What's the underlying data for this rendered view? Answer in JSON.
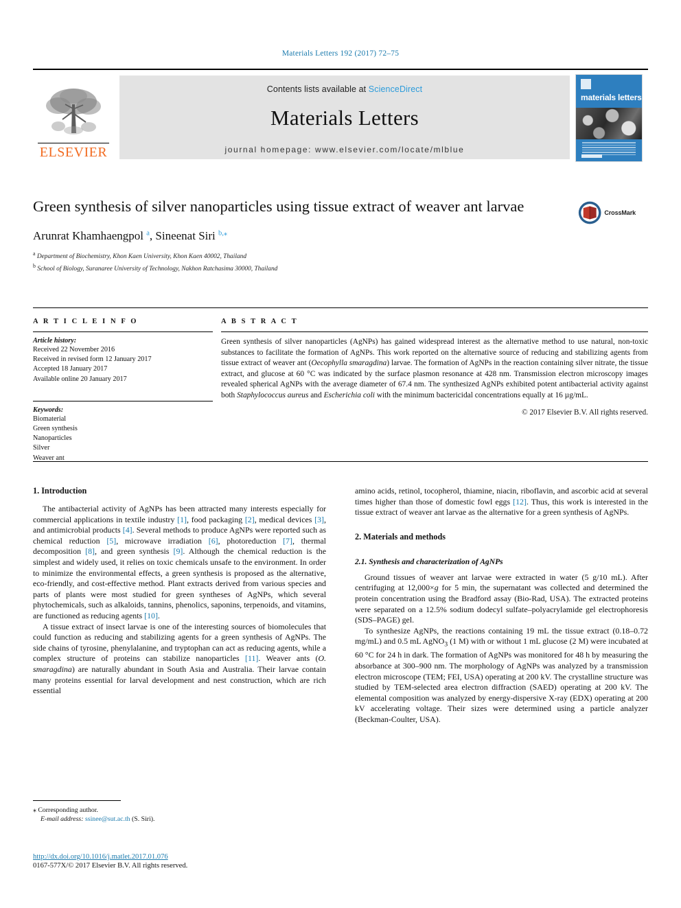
{
  "running_head": "Materials Letters 192 (2017) 72–75",
  "masthead": {
    "publisher": "ELSEVIER",
    "contents_prefix": "Contents lists available at ",
    "sciencedirect": "ScienceDirect",
    "journal_name": "Materials Letters",
    "homepage": "journal homepage: www.elsevier.com/locate/mlblue",
    "cover_title": "materials letters"
  },
  "article": {
    "title": "Green synthesis of silver nanoparticles using tissue extract of weaver ant larvae",
    "crossmark_label": "CrossMark",
    "authors_html": "Arunrat Khamhaengpol <sup>a</sup>, Sineenat Siri <sup>b,</sup><sup>⁎</sup>",
    "affiliation_a": "Department of Biochemistry, Khon Kaen University, Khon Kaen 40002, Thailand",
    "affiliation_b": "School of Biology, Suranaree University of Technology, Nakhon Ratchasima 30000, Thailand"
  },
  "article_info": {
    "heading": "A R T I C L E    I N F O",
    "history_label": "Article history:",
    "history": [
      "Received 22 November 2016",
      "Received in revised form 12 January 2017",
      "Accepted 18 January 2017",
      "Available online 20 January 2017"
    ],
    "keywords_label": "Keywords:",
    "keywords": [
      "Biomaterial",
      "Green synthesis",
      "Nanoparticles",
      "Silver",
      "Weaver ant"
    ]
  },
  "abstract": {
    "heading": "A B S T R A C T",
    "text_html": "Green synthesis of silver nanoparticles (AgNPs) has gained widespread interest as the alternative method to use natural, non-toxic substances to facilitate the formation of AgNPs. This work reported on the alternative source of reducing and stabilizing agents from tissue extract of weaver ant (<i>Oecophylla smaragdina</i>) larvae. The formation of AgNPs in the reaction containing silver nitrate, the tissue extract, and glucose at 60 °C was indicated by the surface plasmon resonance at 428 nm. Transmission electron microscopy images revealed spherical AgNPs with the average diameter of 67.4 nm. The synthesized AgNPs exhibited potent antibacterial activity against both <i>Staphylococcus aureus</i> and <i>Escherichia coli</i> with the minimum bactericidal concentrations equally at 16 µg/mL.",
    "copyright": "© 2017 Elsevier B.V. All rights reserved."
  },
  "sections": {
    "intro_heading": "1. Introduction",
    "intro_p1_html": "The antibacterial activity of AgNPs has been attracted many interests especially for commercial applications in textile industry <span class=\"ref\">[1]</span>, food packaging <span class=\"ref\">[2]</span>, medical devices <span class=\"ref\">[3]</span>, and antimicrobial products <span class=\"ref\">[4]</span>. Several methods to produce AgNPs were reported such as chemical reduction <span class=\"ref\">[5]</span>, microwave irradiation <span class=\"ref\">[6]</span>, photoreduction <span class=\"ref\">[7]</span>, thermal decomposition <span class=\"ref\">[8]</span>, and green synthesis <span class=\"ref\">[9]</span>. Although the chemical reduction is the simplest and widely used, it relies on toxic chemicals unsafe to the environment. In order to minimize the environmental effects, a green synthesis is proposed as the alternative, eco-friendly, and cost-effective method. Plant extracts derived from various species and parts of plants were most studied for green syntheses of AgNPs, which several phytochemicals, such as alkaloids, tannins, phenolics, saponins, terpenoids, and vitamins, are functioned as reducing agents <span class=\"ref\">[10]</span>.",
    "intro_p2_html": "A tissue extract of insect larvae is one of the interesting sources of biomolecules that could function as reducing and stabilizing agents for a green synthesis of AgNPs. The side chains of tyrosine, phenylalanine, and tryptophan can act as reducing agents, while a complex structure of proteins can stabilize nanoparticles <span class=\"ref\">[11]</span>. Weaver ants (<i>O. smaragdina</i>) are naturally abundant in South Asia and Australia. Their larvae contain many proteins essential for larval development and nest construction, which are rich essential",
    "intro_p2_cont_html": "amino acids, retinol, tocopherol, thiamine, niacin, riboflavin, and ascorbic acid at several times higher than those of domestic fowl eggs <span class=\"ref\">[12]</span>. Thus, this work is interested in the tissue extract of weaver ant larvae as the alternative for a green synthesis of AgNPs.",
    "methods_heading": "2. Materials and methods",
    "methods_sub_heading": "2.1. Synthesis and characterization of AgNPs",
    "methods_p1_html": "Ground tissues of weaver ant larvae were extracted in water (5 g/10 mL). After centrifuging at 12,000×<i>g</i> for 5 min, the supernatant was collected and determined the protein concentration using the Bradford assay (Bio-Rad, USA). The extracted proteins were separated on a 12.5% sodium dodecyl sulfate–polyacrylamide gel electrophoresis (SDS–PAGE) gel.",
    "methods_p2_html": "To synthesize AgNPs, the reactions containing 19 mL the tissue extract (0.18–0.72 mg/mL) and 0.5 mL AgNO<sub>3</sub> (1 M) with or without 1 mL glucose (2 M) were incubated at 60 °C for 24 h in dark. The formation of AgNPs was monitored for 48 h by measuring the absorbance at 300–900 nm. The morphology of AgNPs was analyzed by a transmission electron microscope (TEM; FEI, USA) operating at 200 kV. The crystalline structure was studied by TEM-selected area electron diffraction (SAED) operating at 200 kV. The elemental composition was analyzed by energy-dispersive X-ray (EDX) operating at 200 kV accelerating voltage. Their sizes were determined using a particle analyzer (Beckman-Coulter, USA)."
  },
  "footer": {
    "corresponding_marker": "⁎",
    "corresponding_label": "Corresponding author.",
    "email_label": "E-mail address:",
    "email": "ssinee@sut.ac.th",
    "email_suffix": "(S. Siri).",
    "doi": "http://dx.doi.org/10.1016/j.matlet.2017.01.076",
    "issn_line": "0167-577X/© 2017 Elsevier B.V. All rights reserved."
  },
  "colors": {
    "link": "#1a7aad",
    "sciencedirect": "#2d9cdb",
    "elsevier_orange": "#F26B21",
    "cover_blue": "#2e7fbf"
  }
}
